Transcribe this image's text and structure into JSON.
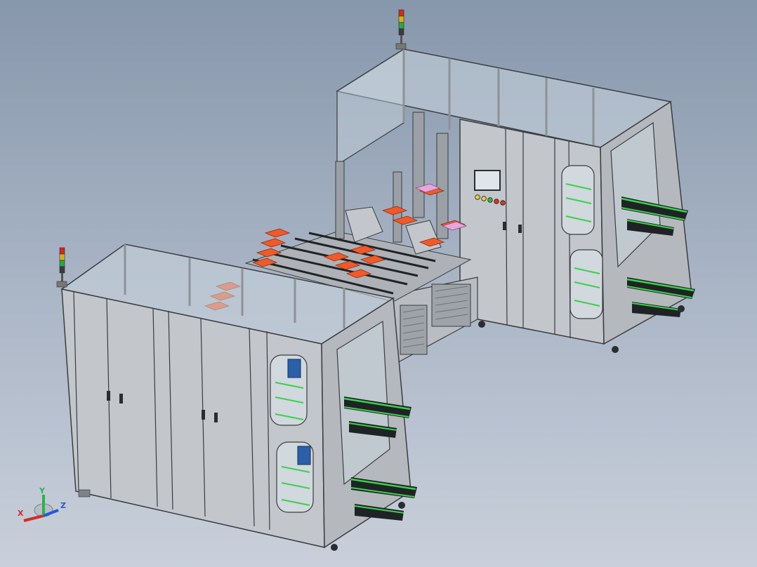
{
  "viewport": {
    "background_top": "#8797ac",
    "background_bottom": "#c9d0db"
  },
  "colors": {
    "frame": "#9fa4aa",
    "panel": "#c3c6ca",
    "panel_dark": "#a9adb2",
    "glass": "#c9d4dc",
    "edge": "#3a3d40",
    "tray": "#f05a2a",
    "rail_green": "#3bd14a",
    "conveyor_black": "#1f2326",
    "motor_blue": "#2b5fa8",
    "pink_tray": "#e7a5d8"
  },
  "signal_tower_colors": [
    "#d12a1e",
    "#d6b21a",
    "#2fa34a",
    "#3a3d40"
  ],
  "control_lamps": [
    "#e8d23a",
    "#e8d23a",
    "#3bb34a",
    "#d7342a",
    "#d7342a"
  ],
  "axis_triad": {
    "x_label": "X",
    "y_label": "Y",
    "z_label": "Z",
    "x_color": "#d62a2a",
    "y_color": "#2cb34a",
    "z_color": "#2a56d6"
  }
}
